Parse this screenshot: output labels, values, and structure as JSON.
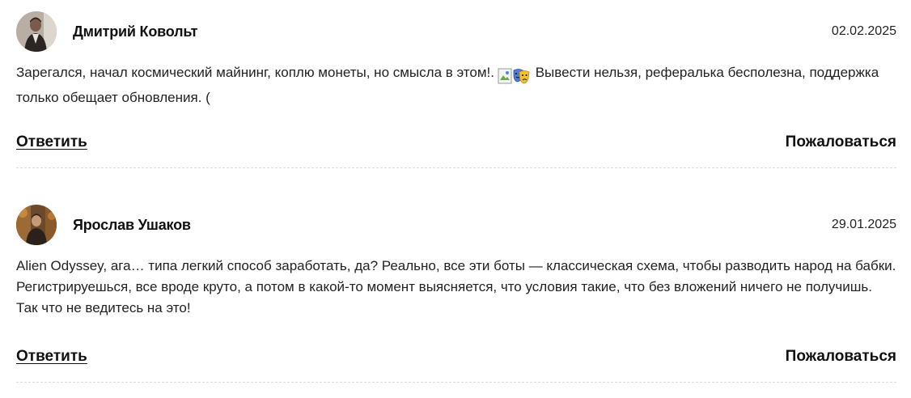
{
  "comments": [
    {
      "author": "Дмитрий Ковольт",
      "date": "02.02.2025",
      "text_before": "Зарегался, начал космический майнинг, коплю монеты, но смысла в этом!.",
      "emoji": "theater-masks-emoji",
      "text_after": "Вывести нельзя, рефералька бесполезна, поддержка только обещает обновления. (",
      "reply_label": "Ответить",
      "report_label": "Пожаловаться"
    },
    {
      "author": "Ярослав Ушаков",
      "date": "29.01.2025",
      "text": "Alien Odyssey, ага… типа легкий способ заработать, да? Реально, все эти боты — классическая схема, чтобы разводить народ на бабки. Регистрируешься, все вроде круто, а потом в какой-то момент выясняется, что условия такие, что без вложений ничего не получишь. Так что не ведитесь на это!",
      "reply_label": "Ответить",
      "report_label": "Пожаловаться"
    }
  ]
}
